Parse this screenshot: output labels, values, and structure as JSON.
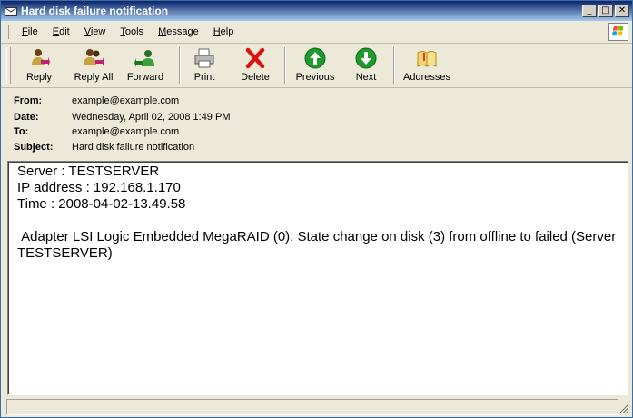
{
  "window": {
    "title": "Hard disk failure notification",
    "controls": [
      "_",
      "□",
      "✕"
    ]
  },
  "menu": [
    "File",
    "Edit",
    "View",
    "Tools",
    "Message",
    "Help"
  ],
  "toolbar": {
    "reply": "Reply",
    "reply_all": "Reply All",
    "forward": "Forward",
    "print": "Print",
    "delete": "Delete",
    "previous": "Previous",
    "next": "Next",
    "addresses": "Addresses"
  },
  "headers": {
    "from_label": "From:",
    "from": "example@example.com",
    "date_label": "Date:",
    "date": "Wednesday, April 02, 2008 1:49 PM",
    "to_label": "To:",
    "to": "example@example.com",
    "subject_label": "Subject:",
    "subject": "Hard disk failure notification"
  },
  "body": {
    "line1": "Server : TESTSERVER",
    "line2": "IP address : 192.168.1.170",
    "line3": "Time : 2008-04-02-13.49.58",
    "line4": " Adapter LSI Logic Embedded MegaRAID (0): State change on disk (3) from offline to failed (Server TESTSERVER)"
  },
  "colors": {
    "titlebar_start": "#0a246a",
    "titlebar_end": "#a6caf0",
    "chrome": "#ece9d8",
    "delete_red": "#e01010",
    "nav_green": "#1e9a2e"
  },
  "icons": {
    "reply": "reply-icon",
    "reply_all": "reply-all-icon",
    "forward": "forward-icon",
    "print": "printer-icon",
    "delete": "delete-x-icon",
    "previous": "up-arrow-icon",
    "next": "down-arrow-icon",
    "addresses": "address-book-icon"
  }
}
